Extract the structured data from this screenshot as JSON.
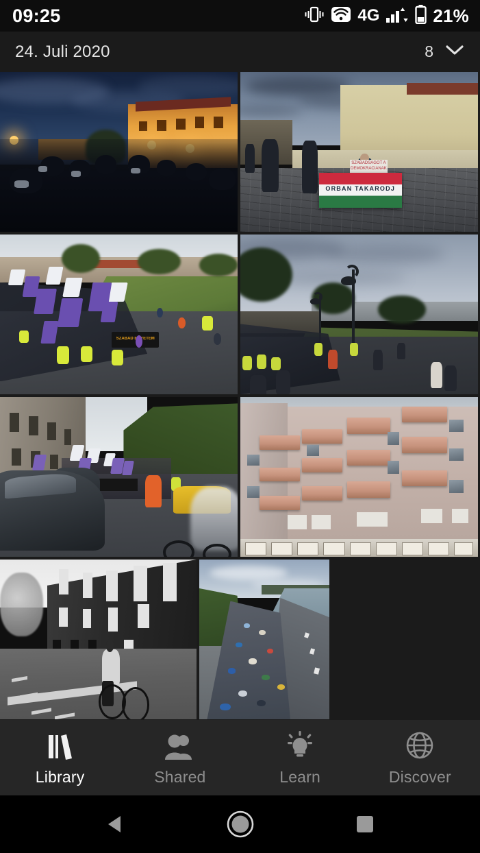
{
  "status_bar": {
    "time": "09:25",
    "battery_percent": "21%",
    "network_type": "4G",
    "icons": [
      "vibrate-icon",
      "wifi-icon",
      "signal-bars-icon",
      "battery-icon"
    ]
  },
  "header": {
    "date": "24. Juli 2020",
    "count": "8",
    "expand_icon": "chevron-down-icon"
  },
  "gallery": {
    "photos": [
      {
        "id": 1,
        "alt": "Night crowd gathered in front of an illuminated building at dusk"
      },
      {
        "id": 2,
        "alt": "Man holding a Hungarian flag with protest text on a cobblestone square",
        "flag_text": "ORBAN TAKARODJ",
        "sign_text": "SZABADSAGOT A DEMOKRACIANAK"
      },
      {
        "id": 3,
        "alt": "Daytime protest march with purple and white flags and yellow-vest marshals",
        "banner_text": "SZABAD EGYETEM"
      },
      {
        "id": 4,
        "alt": "Protest march at dusk viewed from above with tall curved street lamps"
      },
      {
        "id": 5,
        "alt": "Street level view of a march with parked cars, a yellow taxi and a cyclist"
      },
      {
        "id": 6,
        "alt": "Apartment building facade with rows of salmon coloured balconies"
      },
      {
        "id": 7,
        "alt": "Black and white photo of a cyclist riding past a large stone building"
      },
      {
        "id": 8,
        "alt": "Aerial view of a dense crowd marching along a riverside road"
      }
    ]
  },
  "bottom_nav": {
    "items": [
      {
        "label": "Library",
        "icon": "books-icon",
        "active": true
      },
      {
        "label": "Shared",
        "icon": "people-icon",
        "active": false
      },
      {
        "label": "Learn",
        "icon": "lightbulb-icon",
        "active": false
      },
      {
        "label": "Discover",
        "icon": "globe-icon",
        "active": false
      }
    ]
  },
  "system_nav": {
    "back": "back-triangle-icon",
    "home": "home-circle-icon",
    "recents": "recents-square-icon"
  },
  "colors": {
    "background": "#1b1b1b",
    "status_bar": "#0d0d0d",
    "bottom_nav": "#262626",
    "system_nav": "#000000",
    "active_text": "#ffffff",
    "inactive_text": "#8e8e8e"
  }
}
